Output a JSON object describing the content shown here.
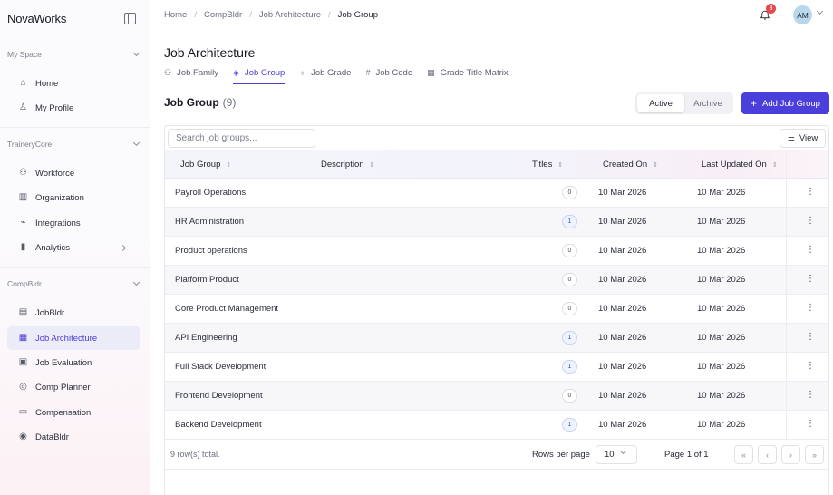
{
  "sidebar": {
    "brand": "NovaWorks",
    "sections": [
      {
        "title": "My Space",
        "items": [
          {
            "label": "Home",
            "icon": "home-icon",
            "glyph": "⌂"
          },
          {
            "label": "My Profile",
            "icon": "user-icon",
            "glyph": "♙"
          }
        ]
      },
      {
        "title": "TraineryCore",
        "items": [
          {
            "label": "Workforce",
            "icon": "users-icon",
            "glyph": "⚇"
          },
          {
            "label": "Organization",
            "icon": "building-icon",
            "glyph": "▥"
          },
          {
            "label": "Integrations",
            "icon": "plug-icon",
            "glyph": "⌁"
          },
          {
            "label": "Analytics",
            "icon": "bar-chart-icon",
            "glyph": "▮"
          }
        ]
      },
      {
        "title": "CompBldr",
        "items": [
          {
            "label": "JobBldr",
            "icon": "clipboard-icon",
            "glyph": "▤"
          },
          {
            "label": "Job Architecture",
            "icon": "grid-icon",
            "glyph": "▦"
          },
          {
            "label": "Job Evaluation",
            "icon": "clipboard-check-icon",
            "glyph": "▣"
          },
          {
            "label": "Comp Planner",
            "icon": "coins-icon",
            "glyph": "◎"
          },
          {
            "label": "Compensation",
            "icon": "wallet-icon",
            "glyph": "▭"
          },
          {
            "label": "DataBldr",
            "icon": "database-icon",
            "glyph": "◉"
          }
        ]
      }
    ]
  },
  "topbar": {
    "breadcrumbs": [
      "Home",
      "CompBldr",
      "Job Architecture",
      "Job Group"
    ],
    "notification_count": "3",
    "avatar_initials": "AM"
  },
  "page": {
    "title": "Job Architecture",
    "tabs": [
      {
        "label": "Job Family",
        "glyph": "⚇"
      },
      {
        "label": "Job Group",
        "glyph": "◈"
      },
      {
        "label": "Job Grade",
        "glyph": "♁"
      },
      {
        "label": "Job Code",
        "glyph": "#"
      },
      {
        "label": "Grade Title Matrix",
        "glyph": "▦"
      }
    ],
    "active_tab": "Job Group",
    "section_title": "Job Group",
    "section_count": "(9)",
    "segment": {
      "active": "Active",
      "archive": "Archive"
    },
    "add_button": "Add Job Group"
  },
  "table": {
    "search_placeholder": "Search job groups...",
    "view_label": "View",
    "columns": [
      "Job Group",
      "Description",
      "Titles",
      "Created On",
      "Last Updated On"
    ],
    "rows": [
      {
        "name": "Payroll Operations",
        "description": "",
        "titles": "0",
        "created": "10 Mar 2026",
        "updated": "10 Mar 2026"
      },
      {
        "name": "HR Administration",
        "description": "",
        "titles": "1",
        "created": "10 Mar 2026",
        "updated": "10 Mar 2026"
      },
      {
        "name": "Product operations",
        "description": "",
        "titles": "0",
        "created": "10 Mar 2026",
        "updated": "10 Mar 2026"
      },
      {
        "name": "Platform Product",
        "description": "",
        "titles": "0",
        "created": "10 Mar 2026",
        "updated": "10 Mar 2026"
      },
      {
        "name": "Core Product Management",
        "description": "",
        "titles": "0",
        "created": "10 Mar 2026",
        "updated": "10 Mar 2026"
      },
      {
        "name": "API Engineering",
        "description": "",
        "titles": "1",
        "created": "10 Mar 2026",
        "updated": "10 Mar 2026"
      },
      {
        "name": "Full Stack Development",
        "description": "",
        "titles": "1",
        "created": "10 Mar 2026",
        "updated": "10 Mar 2026"
      },
      {
        "name": "Frontend Development",
        "description": "",
        "titles": "0",
        "created": "10 Mar 2026",
        "updated": "10 Mar 2026"
      },
      {
        "name": "Backend Development",
        "description": "",
        "titles": "1",
        "created": "10 Mar 2026",
        "updated": "10 Mar 2026"
      }
    ],
    "footer": {
      "total": "9 row(s) total.",
      "rows_per_page_label": "Rows per page",
      "rows_per_page": "10",
      "page_info": "Page 1 of 1"
    }
  },
  "colors": {
    "accent": "#4a3fdb",
    "notification": "#e5484d",
    "avatar": "#b9d7ea"
  }
}
